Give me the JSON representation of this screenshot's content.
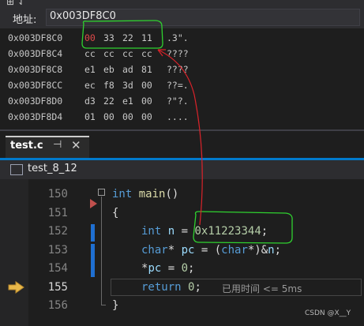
{
  "memory": {
    "header_glyph": "⊞ ⇃",
    "address_label": "地址:",
    "address_value": "0x003DF8C0",
    "rows": [
      {
        "addr": "0x003DF8C0",
        "bytes": [
          "00",
          "33",
          "22",
          "11"
        ],
        "ascii": ".3\"."
      },
      {
        "addr": "0x003DF8C4",
        "bytes": [
          "cc",
          "cc",
          "cc",
          "cc"
        ],
        "ascii": "????"
      },
      {
        "addr": "0x003DF8C8",
        "bytes": [
          "e1",
          "eb",
          "ad",
          "81"
        ],
        "ascii": "????"
      },
      {
        "addr": "0x003DF8CC",
        "bytes": [
          "ec",
          "f8",
          "3d",
          "00"
        ],
        "ascii": "??=."
      },
      {
        "addr": "0x003DF8D0",
        "bytes": [
          "d3",
          "22",
          "e1",
          "00"
        ],
        "ascii": "?\"?."
      },
      {
        "addr": "0x003DF8D4",
        "bytes": [
          "01",
          "00",
          "00",
          "00"
        ],
        "ascii": "...."
      }
    ],
    "changed_byte_color": "#e04a4a"
  },
  "tab": {
    "label": "test.c",
    "pin_glyph": "⊣",
    "close_glyph": "✕"
  },
  "nav": {
    "label": "test_8_12"
  },
  "editor": {
    "lines": [
      {
        "number": "150",
        "code_tokens": [
          {
            "t": "int",
            "c": "kw"
          },
          {
            "t": " ",
            "c": ""
          },
          {
            "t": "main",
            "c": "fn"
          },
          {
            "t": "()",
            "c": ""
          }
        ]
      },
      {
        "number": "151",
        "code_tokens": [
          {
            "t": "{",
            "c": ""
          }
        ]
      },
      {
        "number": "152",
        "code_tokens": [
          {
            "t": "int",
            "c": "kw"
          },
          {
            "t": " ",
            "c": ""
          },
          {
            "t": "n",
            "c": "ident"
          },
          {
            "t": " = ",
            "c": ""
          },
          {
            "t": "0x11223344",
            "c": "num"
          },
          {
            "t": ";",
            "c": ""
          }
        ]
      },
      {
        "number": "153",
        "code_tokens": [
          {
            "t": "char",
            "c": "kw"
          },
          {
            "t": "* ",
            "c": ""
          },
          {
            "t": "pc",
            "c": "ident"
          },
          {
            "t": " = (",
            "c": ""
          },
          {
            "t": "char",
            "c": "kw"
          },
          {
            "t": "*)&",
            "c": ""
          },
          {
            "t": "n",
            "c": "ident"
          },
          {
            "t": ";",
            "c": ""
          }
        ]
      },
      {
        "number": "154",
        "code_tokens": [
          {
            "t": "*",
            "c": ""
          },
          {
            "t": "pc",
            "c": "ident"
          },
          {
            "t": " = ",
            "c": ""
          },
          {
            "t": "0",
            "c": "num"
          },
          {
            "t": ";",
            "c": ""
          }
        ]
      },
      {
        "number": "155",
        "code_tokens": [
          {
            "t": "return",
            "c": "kw"
          },
          {
            "t": " ",
            "c": ""
          },
          {
            "t": "0",
            "c": "num"
          },
          {
            "t": ";",
            "c": ""
          }
        ]
      },
      {
        "number": "156",
        "code_tokens": [
          {
            "t": "}",
            "c": ""
          }
        ]
      }
    ],
    "perf_tip": "已用时间 <= 5ms"
  },
  "watermark": "CSDN @X__Y",
  "annotation_color": "#2fd12f",
  "arrow_color": "#d9232a"
}
